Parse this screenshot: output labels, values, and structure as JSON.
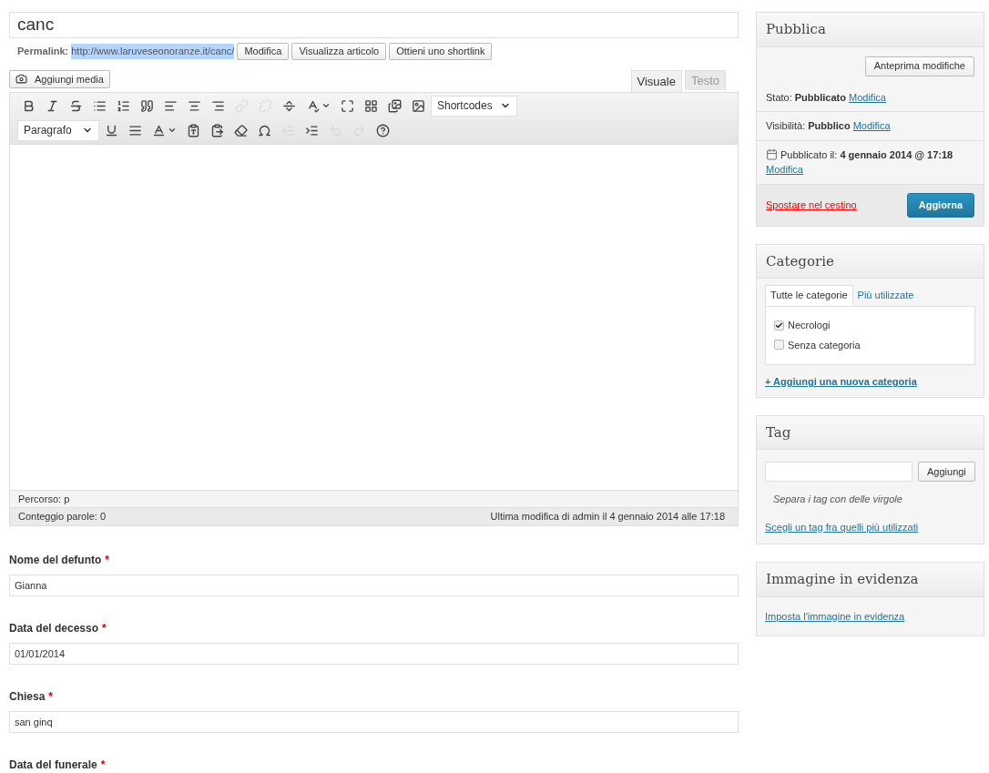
{
  "title_field": {
    "value": "canc"
  },
  "permalink": {
    "label": "Permalink:",
    "url": "http://www.laruveseonoranze.it/canc/",
    "buttons": [
      "Modifica",
      "Visualizza articolo",
      "Ottieni uno shortlink"
    ]
  },
  "add_media": {
    "label": "Aggiungi media"
  },
  "editor_tabs": [
    {
      "label": "Visuale",
      "selected": true
    },
    {
      "label": "Testo",
      "selected": false
    }
  ],
  "toolbar_rows": [
    [
      {
        "kind": "bold",
        "disabled": false
      },
      {
        "kind": "italic",
        "disabled": false
      },
      {
        "kind": "strike",
        "disabled": false
      },
      {
        "kind": "bullets",
        "disabled": false
      },
      {
        "kind": "numbers",
        "disabled": false
      },
      {
        "kind": "quote",
        "disabled": false
      },
      {
        "kind": "align-left",
        "disabled": false
      },
      {
        "kind": "align-center",
        "disabled": false
      },
      {
        "kind": "align-right",
        "disabled": false
      },
      {
        "kind": "link",
        "disabled": true
      },
      {
        "kind": "unlink",
        "disabled": true
      },
      {
        "kind": "more",
        "disabled": false
      },
      {
        "kind": "spellcheck",
        "disabled": false
      },
      {
        "kind": "fullscreen",
        "disabled": false
      },
      {
        "kind": "kitchen",
        "disabled": false
      },
      {
        "kind": "gallery",
        "disabled": false
      },
      {
        "kind": "image",
        "disabled": false
      },
      {
        "kind": "select",
        "label": "Shortcodes"
      }
    ],
    [
      {
        "kind": "select",
        "label": "Paragrafo"
      },
      {
        "kind": "underline",
        "disabled": false
      },
      {
        "kind": "justify",
        "disabled": false
      },
      {
        "kind": "color",
        "disabled": false
      },
      {
        "kind": "paste-text",
        "disabled": false
      },
      {
        "kind": "paste-word",
        "disabled": false
      },
      {
        "kind": "eraser",
        "disabled": false
      },
      {
        "kind": "omega",
        "disabled": false
      },
      {
        "kind": "outdent",
        "disabled": true
      },
      {
        "kind": "indent",
        "disabled": false
      },
      {
        "kind": "undo",
        "disabled": true
      },
      {
        "kind": "redo",
        "disabled": true
      },
      {
        "kind": "help",
        "disabled": false
      }
    ]
  ],
  "path_bar": "Percorso: p",
  "word_count": "Conteggio parole: 0",
  "last_modified": "Ultima modifica di admin il 4 gennaio 2014 alle 17:18",
  "custom_fields": [
    {
      "label": "Nome del defunto",
      "required_mark": "*",
      "value": "Gianna"
    },
    {
      "label": "Data del decesso",
      "required_mark": "*",
      "value": "01/01/2014"
    },
    {
      "label": "Chiesa",
      "required_mark": "*",
      "value": "san ginq"
    },
    {
      "label": "Data del funerale",
      "required_mark": "*"
    }
  ],
  "publish_box": {
    "title": "Pubblica",
    "preview_button": "Anteprima modifiche",
    "rows": [
      {
        "label": "Stato:",
        "value": "Pubblicato",
        "link": "Modifica"
      },
      {
        "label": "Visibilità:",
        "value": "Pubblico",
        "link": "Modifica"
      },
      {
        "label": "Pubblicato il:",
        "value": "4 gennaio 2014 @ 17:18",
        "link": "Modifica"
      }
    ],
    "trash_link": "Spostare nel cestino",
    "update_button": "Aggiorna"
  },
  "categories_box": {
    "title": "Categorie",
    "tabs": [
      {
        "label": "Tutte le categorie",
        "selected": true
      },
      {
        "label": "Più utilizzate",
        "selected": false
      }
    ],
    "items": [
      {
        "label": "Necrologi",
        "checked": true
      },
      {
        "label": "Senza categoria",
        "checked": false
      }
    ],
    "add_link": "+ Aggiungi una nuova categoria"
  },
  "tag_box": {
    "title": "Tag",
    "add_button": "Aggiungi",
    "hint": "Separa i tag con delle virgole",
    "choose_link": "Scegli un tag fra quelli più utilizzati"
  },
  "featured_image_box": {
    "title": "Immagine in evidenza",
    "link": "Imposta l'immagine in evidenza"
  }
}
